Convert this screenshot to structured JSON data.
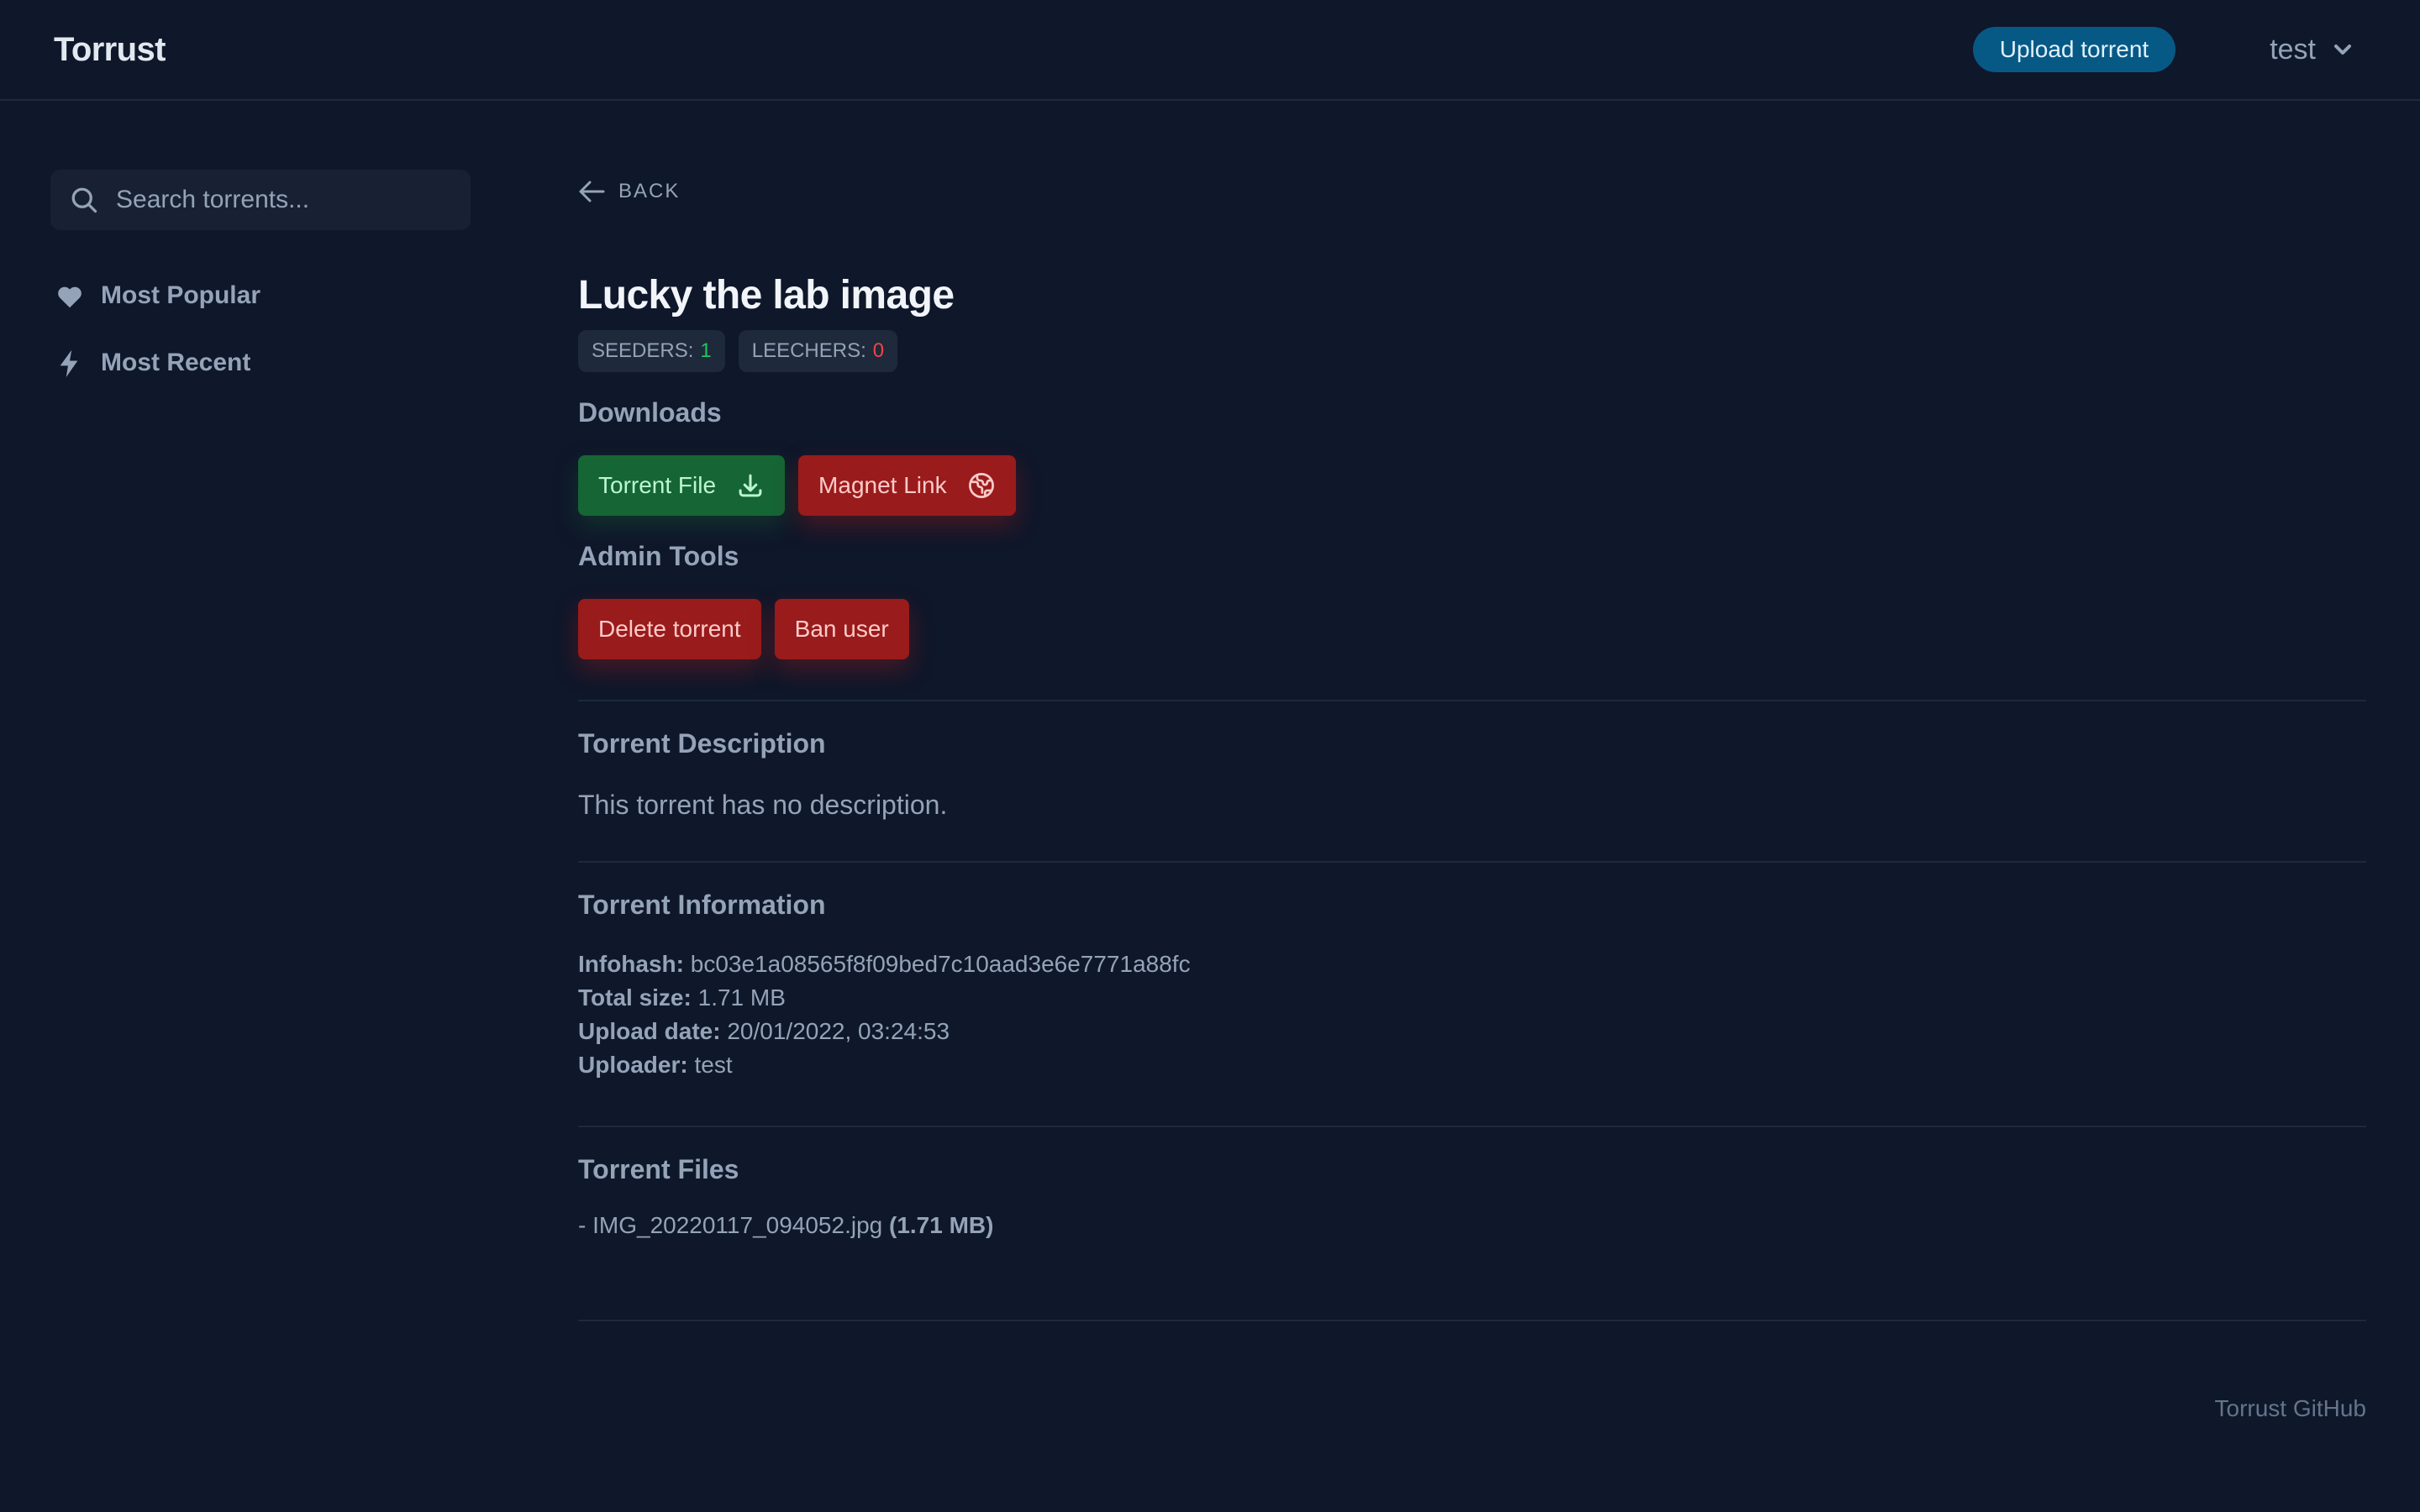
{
  "header": {
    "brand": "Torrust",
    "upload_label": "Upload torrent",
    "user_name": "test",
    "user_menu_icon": "chevron-down-icon"
  },
  "sidebar": {
    "search_placeholder": "Search torrents...",
    "search_value": "",
    "items": [
      {
        "label": "Most Popular",
        "icon": "heart-icon"
      },
      {
        "label": "Most Recent",
        "icon": "lightning-icon"
      }
    ]
  },
  "torrent": {
    "back_label": "BACK",
    "title": "Lucky the lab image",
    "seeders_label": "SEEDERS:",
    "seeders": "1",
    "leechers_label": "LEECHERS:",
    "leechers": "0",
    "downloads_heading": "Downloads",
    "torrent_file_label": "Torrent File",
    "magnet_link_label": "Magnet Link",
    "admin_heading": "Admin Tools",
    "delete_label": "Delete torrent",
    "ban_label": "Ban user",
    "description_heading": "Torrent Description",
    "description": "This torrent has no description.",
    "info_heading": "Torrent Information",
    "info": [
      {
        "label": "Infohash:",
        "value": "bc03e1a08565f8f09bed7c10aad3e6e7771a88fc"
      },
      {
        "label": "Total size:",
        "value": "1.71 MB"
      },
      {
        "label": "Upload date:",
        "value": "20/01/2022, 03:24:53"
      },
      {
        "label": "Uploader:",
        "value": "test"
      }
    ],
    "files_heading": "Torrent Files",
    "files": [
      {
        "prefix": "-",
        "name": "IMG_20220117_094052.jpg",
        "size": "(1.71 MB)"
      }
    ]
  },
  "footer": {
    "link_label": "Torrust GitHub"
  },
  "colors": {
    "background": "#0f172a",
    "upload_button": "#075985",
    "green_button": "#166534",
    "red_button": "#991b1b",
    "seeders_value": "#22c55e",
    "leechers_value": "#ef4444"
  }
}
